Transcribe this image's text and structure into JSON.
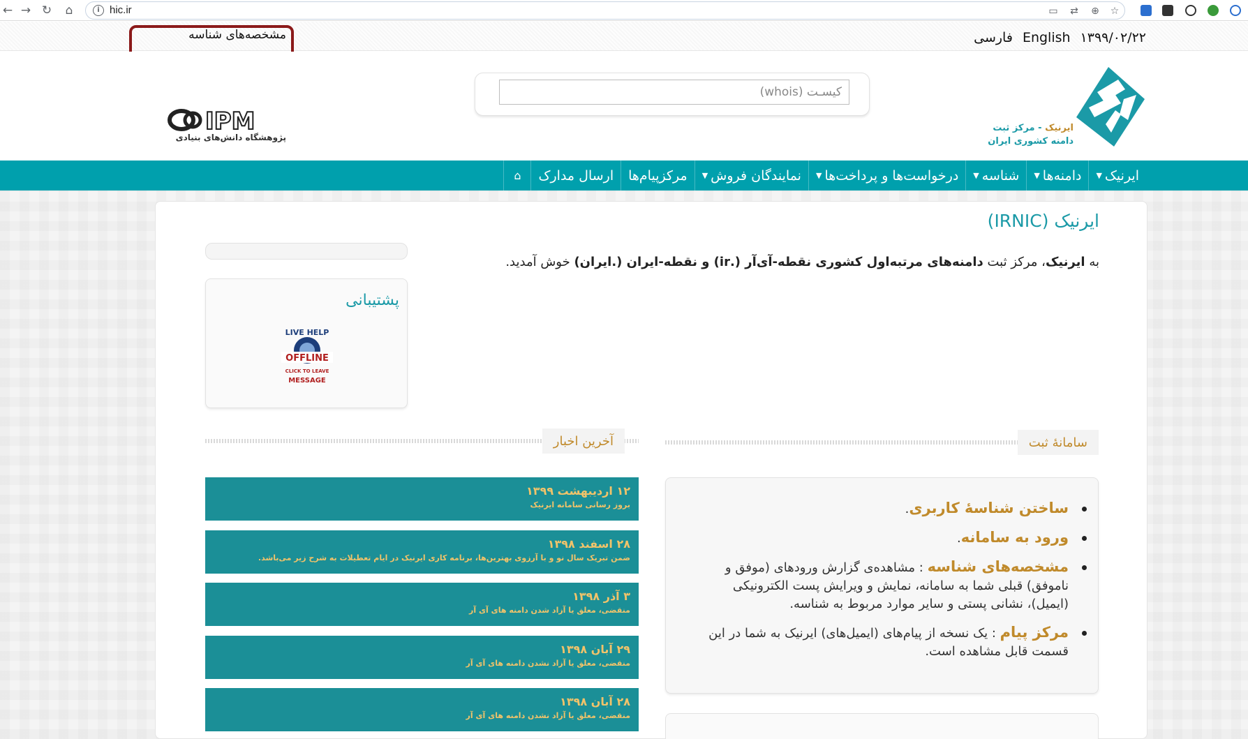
{
  "browser": {
    "url": "hic.ir",
    "icons": [
      "back-icon",
      "forward-icon",
      "reload-icon",
      "home-icon",
      "info-icon",
      "cast-icon",
      "translate-icon",
      "zoom-icon",
      "star-icon"
    ]
  },
  "topbar": {
    "profile_link": "مشخصه‌های شناسه",
    "date": "۱۳۹۹/۰۲/۲۲",
    "lang_en": "English",
    "lang_fa": "فارسی"
  },
  "header": {
    "search_placeholder": "کیسـت (whois)",
    "irnic_caption_brand": "ایرنیک",
    "irnic_caption_line1": " - مرکز ثبت",
    "irnic_caption_line2": "دامنه کشوری ایران",
    "ipm_logo_text": "IPM",
    "ipm_caption": "پژوهشگاه دانش‌های بنیادی"
  },
  "nav": {
    "items": [
      {
        "label": "ایرنیک",
        "dropdown": true
      },
      {
        "label": "دامنه‌ها",
        "dropdown": true
      },
      {
        "label": "شناسه",
        "dropdown": true
      },
      {
        "label": "درخواست‌ها و پرداخت‌ها",
        "dropdown": true
      },
      {
        "label": "نمایندگان فروش",
        "dropdown": true
      },
      {
        "label": "مرکزپیام‌ها",
        "dropdown": false
      },
      {
        "label": "ارسال مدارک",
        "dropdown": false
      }
    ],
    "home_glyph": "⌂"
  },
  "main": {
    "title": "ایرنیک (IRNIC)",
    "welcome_prefix": "به ",
    "welcome_brand": "ایرنیک",
    "welcome_mid": "، مرکز ثبت ",
    "welcome_bold": "دامنه‌های مرتبه‌اول کشوری نقطه-آی‌آر (.ir) و نقطه-ایران (.ایران)",
    "welcome_suffix": " خوش آمدید."
  },
  "sidebar": {
    "support_title": "پشتیبانی",
    "livehelp": {
      "top": "LIVE HELP",
      "status": "OFFLINE",
      "line1": "CLICK TO LEAVE",
      "line2": "MESSAGE"
    }
  },
  "registration": {
    "heading": "سامانهٔ ثبت",
    "items": [
      {
        "link": "ساختن شناسهٔ کاربری",
        "text": "."
      },
      {
        "link": "ورود به سامانه",
        "text": "."
      },
      {
        "link": "مشخصه‌های شناسه",
        "text": " : مشاهده‌ی گزارش ورودهای (موفق و ناموفق) قبلی شما به سامانه، نمایش و ویرایش پست الکترونیکی (ایمیل)، نشانی پستی و سایر موارد مربوط به شناسه."
      },
      {
        "link": "مرکز پیام",
        "text": " : یک نسخه از پیام‌های (ایمیل‌های) ایرنیک به شما در این قسمت قابل مشاهده است."
      }
    ]
  },
  "news": {
    "heading": "آخرین اخبار",
    "items": [
      {
        "date": "۱۲ اردیبهشت ۱۳۹۹",
        "text": "بروز رسانی سامانه ایرنیک"
      },
      {
        "date": "۲۸ اسفند ۱۳۹۸",
        "text": "ضمن تبریک سال نو و با آرزوی بهترین‌ها، برنامه کاری ایرنیک در ایام تعطیلات به شرح زیر می‌باشد."
      },
      {
        "date": "۳ آذر ۱۳۹۸",
        "text": "منقضی، معلق یا آزاد شدن دامنه های آی آر"
      },
      {
        "date": "۲۹ آبان ۱۳۹۸",
        "text": "منقضی، معلق یا آزاد نشدن دامنه های آی آر"
      },
      {
        "date": "۲۸ آبان ۱۳۹۸",
        "text": "منقضی، معلق یا آزاد نشدن دامنه های آی آر"
      }
    ]
  },
  "colors": {
    "teal": "#00a0ad",
    "dark_teal": "#1b8f97",
    "gold": "#c08a2b",
    "highlight": "#8b1a1a"
  }
}
